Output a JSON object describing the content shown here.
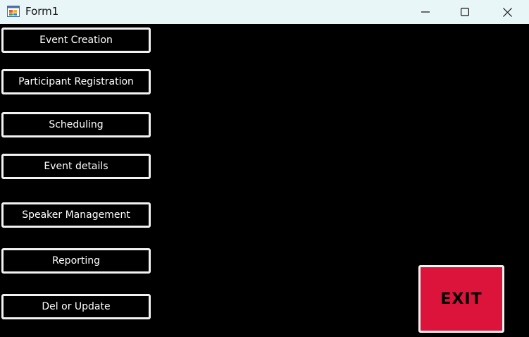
{
  "window": {
    "title": "Form1",
    "icon": "windows-form-icon",
    "controls": [
      "minimize-icon",
      "maximize-icon",
      "close-icon"
    ]
  },
  "menu": {
    "buttons": [
      {
        "label": "Event Creation"
      },
      {
        "label": "Participant Registration"
      },
      {
        "label": "Scheduling"
      },
      {
        "label": "Event details"
      },
      {
        "label": "Speaker Management"
      },
      {
        "label": "Reporting"
      },
      {
        "label": "Del or Update"
      }
    ]
  },
  "exit": {
    "label": "EXIT"
  },
  "colors": {
    "background": "#000000",
    "titlebar": "#e8f6f8",
    "button_border": "#f2f2f2",
    "exit_background": "#dc143c"
  }
}
